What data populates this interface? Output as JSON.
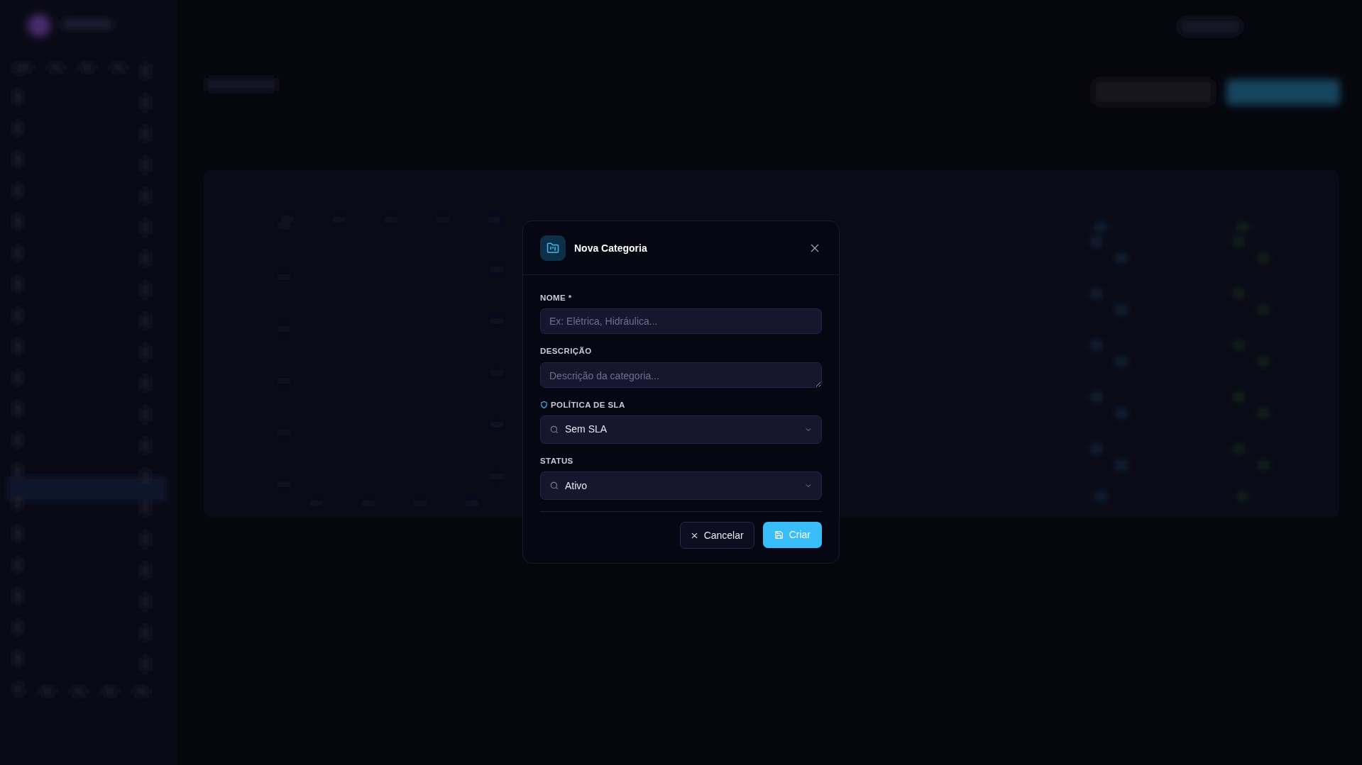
{
  "dialog": {
    "title": "Nova Categoria",
    "fields": [
      {
        "kind": "text",
        "label": "NOME",
        "required_mark": "*",
        "placeholder": "Ex: Elétrica, Hidráulica..."
      },
      {
        "kind": "textarea",
        "label": "DESCRIÇÃO",
        "placeholder": "Descrição da categoria..."
      },
      {
        "kind": "policy",
        "label": "POLÍTICA DE SLA",
        "value": "Sem SLA"
      },
      {
        "kind": "select",
        "label": "STATUS",
        "value": "Ativo"
      }
    ],
    "buttons": [
      {
        "kind": "secondary",
        "label": "Cancelar"
      },
      {
        "kind": "primary",
        "label": "Criar"
      }
    ]
  }
}
